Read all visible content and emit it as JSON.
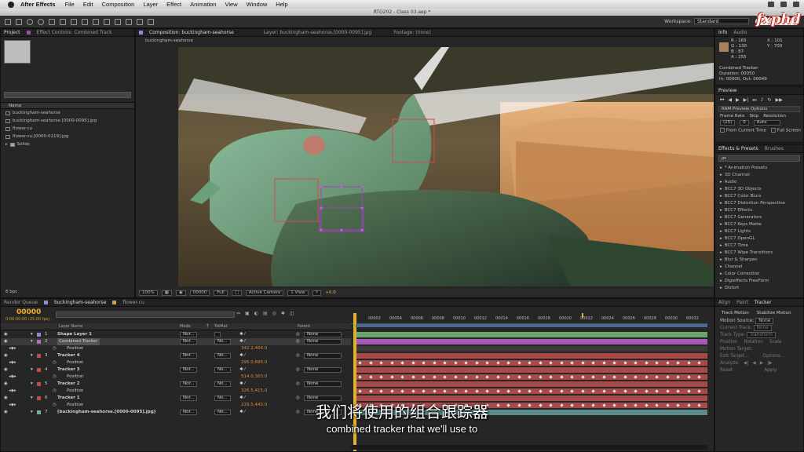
{
  "menubar": {
    "app_name": "After Effects",
    "items": [
      "File",
      "Edit",
      "Composition",
      "Layer",
      "Effect",
      "Animation",
      "View",
      "Window",
      "Help"
    ]
  },
  "window_title": "RTO202 - Class 03.aep *",
  "toolbar": {
    "workspace_label": "Workspace:",
    "workspace_value": "Standard",
    "search_placeholder": "Search Help"
  },
  "logo_text": "fxphd",
  "project_panel": {
    "tab_project": "Project",
    "tab_effect_controls": "Effect Controls: Combined Track",
    "column_name": "Name",
    "items": [
      "buckingham-seahorse",
      "buckingham-seahorse.[0000-0095].jpg",
      "flower-cu",
      "flower-cu.[0000-0119].jpg",
      "Solids"
    ],
    "bpc": "8 bpc"
  },
  "viewer": {
    "tab_comp": "Composition: buckingham-seahorse",
    "tab_layer": "Layer: buckingham-seahorse.[0000-0095].jpg",
    "tab_footage": "Footage: (none)",
    "breadcrumb": "buckingham-seahorse",
    "zoom": "100%",
    "timecode": "00000",
    "resolution": "Full",
    "camera": "Active Camera",
    "views": "1 View",
    "exposure": "+0.0"
  },
  "info_panel": {
    "tab_info": "Info",
    "tab_audio": "Audio",
    "r": "R : 165",
    "g": "G : 130",
    "b": "B : 87",
    "a": "A : 255",
    "x": "X : 101",
    "y": "Y : 700",
    "swatch_color": "#a58257",
    "layer_name": "Combined Tracker",
    "duration": "Duration: 00050",
    "in_out": "In: 00000, Out: 00049"
  },
  "preview_panel": {
    "tab": "Preview",
    "ram_options": "RAM Preview Options",
    "frame_rate_label": "Frame Rate",
    "skip_label": "Skip",
    "resolution_label": "Resolution",
    "frame_rate": "(25)",
    "skip": "0",
    "resolution": "Auto",
    "from_current": "From Current Time",
    "full_screen": "Full Screen"
  },
  "effects_panel": {
    "tab_effects": "Effects & Presets",
    "tab_brushes": "Brushes",
    "search_placeholder": "ρ▾",
    "items": [
      "* Animation Presets",
      "3D Channel",
      "Audio",
      "BCC7 3D Objects",
      "BCC7 Color Blurs",
      "BCC7 Distortion Perspective",
      "BCC7 Effects",
      "BCC7 Generators",
      "BCC7 Keys Matte",
      "BCC7 Lights",
      "BCC7 OpenGL",
      "BCC7 Time",
      "BCC7 Wipe Transitions",
      "Blur & Sharpen",
      "Channel",
      "Color Correction",
      "Digieffects FreeForm",
      "Distort"
    ]
  },
  "tracker_panel": {
    "tab_align": "Align",
    "tab_paint": "Paint",
    "tab_tracker": "Tracker",
    "track_motion": "Track Motion",
    "stabilize_motion": "Stabilize Motion",
    "motion_source_label": "Motion Source:",
    "motion_source": "None",
    "current_track_label": "Current Track:",
    "current_track": "None",
    "track_type_label": "Track Type:",
    "track_type": "Transform",
    "position": "Position",
    "rotation": "Rotation",
    "scale": "Scale",
    "motion_target": "Motion Target:",
    "edit_target": "Edit Target...",
    "options": "Options...",
    "analyze": "Analyze:",
    "reset": "Reset",
    "apply": "Apply"
  },
  "timeline": {
    "tab_render_queue": "Render Queue",
    "tab_comp": "buckingham-seahorse",
    "tab_comp2": "flower-cu",
    "current_time": "00000",
    "fps": "0:00:00:00 (25.00 fps)",
    "col_layer_name": "Layer Name",
    "col_mode": "Mode",
    "col_t": "T",
    "col_trkmat": "TrkMat",
    "col_parent": "Parent",
    "ruler": [
      "00002",
      "00004",
      "00006",
      "00008",
      "00010",
      "00012",
      "00014",
      "00016",
      "00018",
      "00020",
      "00022",
      "00024",
      "00026",
      "00028",
      "00030",
      "00032"
    ],
    "rows": [
      {
        "num": "1",
        "name": "Shape Layer 1",
        "mode": "Nor...",
        "trkmat": "",
        "parent": "None",
        "color": "#8c8cd9",
        "kind": "layer",
        "track": "#6aa66a",
        "star": true
      },
      {
        "num": "2",
        "name": "Combined Tracker",
        "mode": "Nor...",
        "trkmat": "No...",
        "parent": "None",
        "color": "#b66ac2",
        "kind": "layer",
        "track": "#a85ab8",
        "selected": true
      },
      {
        "num": "",
        "name": "Position",
        "value": "342.2,464.0",
        "kind": "prop",
        "track": "#3a3a3a"
      },
      {
        "num": "3",
        "name": "Tracker 4",
        "mode": "Nor...",
        "trkmat": "No...",
        "parent": "None",
        "color": "#c24a4a",
        "kind": "layer",
        "track": "#a84a4a"
      },
      {
        "num": "",
        "name": "Position",
        "value": "295.0,695.0",
        "kind": "prop",
        "track": "#a84a4a",
        "keys": true
      },
      {
        "num": "4",
        "name": "Tracker 3",
        "mode": "Nor...",
        "trkmat": "No...",
        "parent": "None",
        "color": "#c24a4a",
        "kind": "layer",
        "track": "#a84a4a"
      },
      {
        "num": "",
        "name": "Position",
        "value": "514.0,303.0",
        "kind": "prop",
        "track": "#a84a4a",
        "keys": true
      },
      {
        "num": "5",
        "name": "Tracker 2",
        "mode": "Nor...",
        "trkmat": "No...",
        "parent": "None",
        "color": "#c24a4a",
        "kind": "layer",
        "track": "#a84a4a"
      },
      {
        "num": "",
        "name": "Position",
        "value": "326.5,415.0",
        "kind": "prop",
        "track": "#a84a4a",
        "keys": true
      },
      {
        "num": "6",
        "name": "Tracker 1",
        "mode": "Nor...",
        "trkmat": "No...",
        "parent": "None",
        "color": "#c24a4a",
        "kind": "layer",
        "track": "#a84a4a"
      },
      {
        "num": "",
        "name": "Position",
        "value": "233.5,443.0",
        "kind": "prop",
        "track": "#a84a4a",
        "keys": true
      },
      {
        "num": "7",
        "name": "[buckingham-seahorse.[0000-0095].jpg]",
        "mode": "Nor...",
        "trkmat": "No...",
        "parent": "None",
        "color": "#6ab0b0",
        "kind": "layer",
        "track": "#5a8a8a"
      }
    ]
  },
  "subtitles": {
    "zh": "我们将使用的组合跟踪器",
    "en": "combined tracker that we'll use to"
  }
}
